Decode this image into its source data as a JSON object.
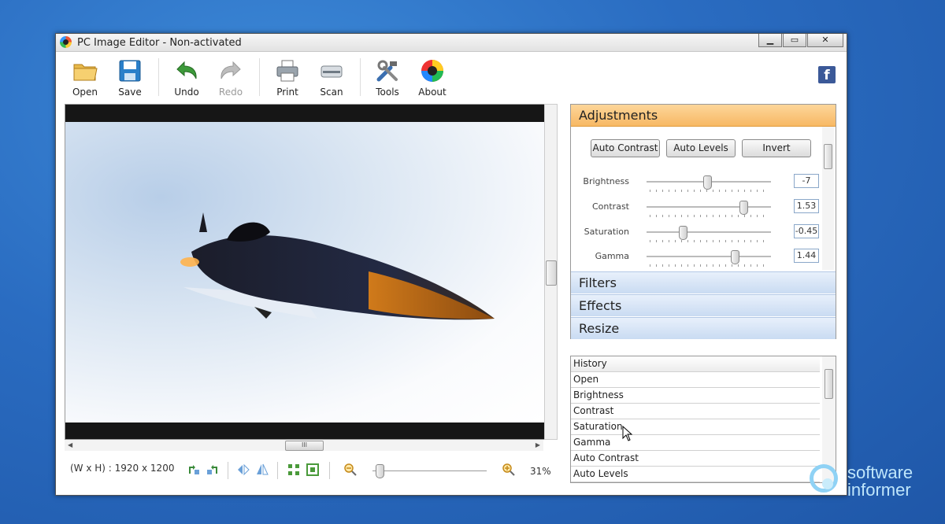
{
  "window": {
    "title": "PC Image Editor - Non-activated",
    "min_label": "▁",
    "max_label": "▭",
    "close_label": "✕"
  },
  "toolbar": {
    "open": "Open",
    "save": "Save",
    "undo": "Undo",
    "redo": "Redo",
    "print": "Print",
    "scan": "Scan",
    "tools": "Tools",
    "about": "About",
    "facebook": "f"
  },
  "canvas": {
    "hscroll_grip": "III"
  },
  "status": {
    "dimensions": "(W x H) : 1920 x 1200",
    "zoom_percent": "31%",
    "zoom_level": 0.06
  },
  "adjustments": {
    "title": "Adjustments",
    "buttons": {
      "auto_contrast": "Auto Contrast",
      "auto_levels": "Auto Levels",
      "invert": "Invert"
    },
    "sliders": [
      {
        "label": "Brightness",
        "value": "-7",
        "position": 0.49
      },
      {
        "label": "Contrast",
        "value": "1.53",
        "position": 0.78
      },
      {
        "label": "Saturation",
        "value": "-0.45",
        "position": 0.29
      },
      {
        "label": "Gamma",
        "value": "1.44",
        "position": 0.71
      }
    ]
  },
  "sections": {
    "filters": "Filters",
    "effects": "Effects",
    "resize": "Resize"
  },
  "history": {
    "header": "History",
    "items": [
      "Open",
      "Brightness",
      "Contrast",
      "Saturation",
      "Gamma",
      "Auto Contrast",
      "Auto Levels"
    ]
  },
  "watermark": {
    "line1": "software",
    "line2": "informer"
  },
  "colors": {
    "desktop": "#2a6cc1",
    "active_section": "#f7b864",
    "section": "#c9dbf2"
  }
}
